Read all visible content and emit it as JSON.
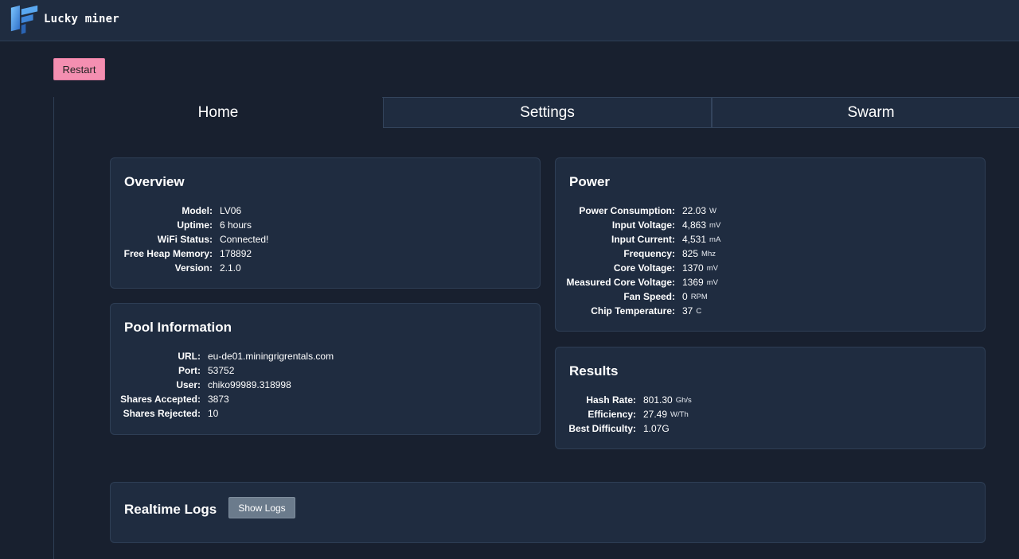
{
  "brand": {
    "name": "Lucky miner",
    "logo_icon": "lucky-miner-logo"
  },
  "toolbar": {
    "restart_label": "Restart"
  },
  "tabs": [
    {
      "label": "Home",
      "active": true
    },
    {
      "label": "Settings",
      "active": false
    },
    {
      "label": "Swarm",
      "active": false
    }
  ],
  "overview": {
    "title": "Overview",
    "rows": [
      {
        "key": "Model:",
        "value": "LV06"
      },
      {
        "key": "Uptime:",
        "value": "6 hours"
      },
      {
        "key": "WiFi Status:",
        "value": "Connected!"
      },
      {
        "key": "Free Heap Memory:",
        "value": "178892"
      },
      {
        "key": "Version:",
        "value": "2.1.0"
      }
    ]
  },
  "pool": {
    "title": "Pool Information",
    "rows": [
      {
        "key": "URL:",
        "value": "eu-de01.miningrigrentals.com"
      },
      {
        "key": "Port:",
        "value": "53752"
      },
      {
        "key": "User:",
        "value": "chiko99989.318998"
      },
      {
        "key": "Shares Accepted:",
        "value": "3873"
      },
      {
        "key": "Shares Rejected:",
        "value": "10"
      }
    ]
  },
  "power": {
    "title": "Power",
    "rows": [
      {
        "key": "Power Consumption:",
        "value": "22.03",
        "unit": "W"
      },
      {
        "key": "Input Voltage:",
        "value": "4,863",
        "unit": "mV"
      },
      {
        "key": "Input Current:",
        "value": "4,531",
        "unit": "mA"
      },
      {
        "key": "Frequency:",
        "value": "825",
        "unit": "Mhz"
      },
      {
        "key": "Core Voltage:",
        "value": "1370",
        "unit": "mV"
      },
      {
        "key": "Measured Core Voltage:",
        "value": "1369",
        "unit": "mV"
      },
      {
        "key": "Fan Speed:",
        "value": "0",
        "unit": "RPM"
      },
      {
        "key": "Chip Temperature:",
        "value": "37",
        "unit": "C"
      }
    ]
  },
  "results": {
    "title": "Results",
    "rows": [
      {
        "key": "Hash Rate:",
        "value": "801.30",
        "unit": "Gh/s"
      },
      {
        "key": "Efficiency:",
        "value": "27.49",
        "unit": "W/Th"
      },
      {
        "key": "Best Difficulty:",
        "value": "1.07G"
      }
    ]
  },
  "logs": {
    "title": "Realtime Logs",
    "show_label": "Show Logs"
  },
  "colors": {
    "background": "#18202f",
    "card": "#1f2c40",
    "restart_button": "#f48fb1",
    "logs_button": "#6b7b8c"
  }
}
